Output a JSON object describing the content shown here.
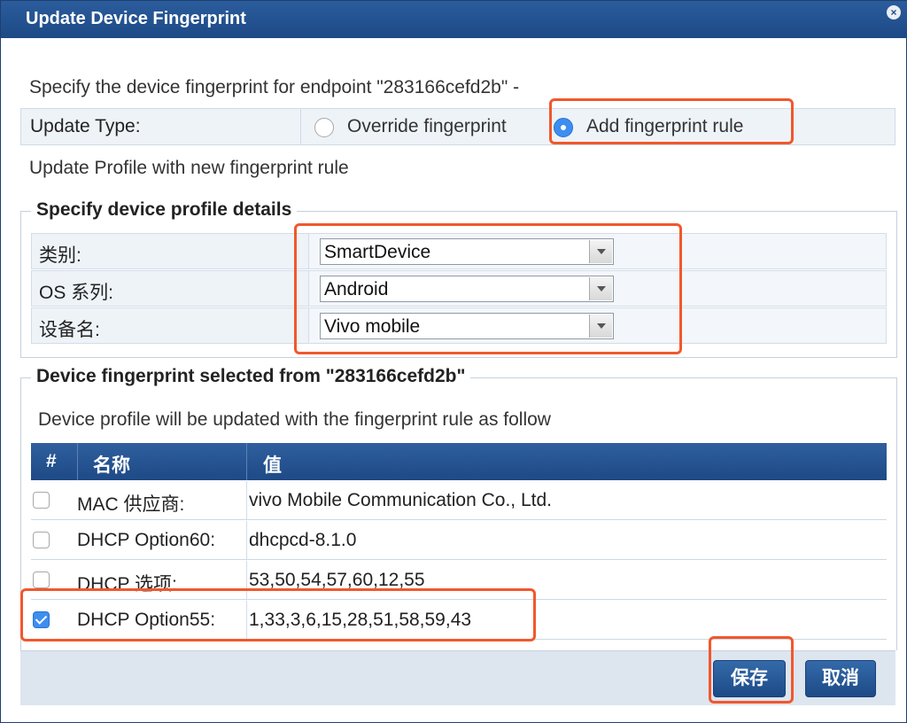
{
  "dialog": {
    "title": "Update Device Fingerprint",
    "close_label": "×"
  },
  "intro": "Specify the device fingerprint for endpoint \"283166cefd2b\" -",
  "update_type": {
    "label": "Update Type:",
    "options": [
      {
        "label": "Override fingerprint",
        "selected": false
      },
      {
        "label": "Add fingerprint rule",
        "selected": true
      }
    ]
  },
  "profile_note": "Update Profile with new fingerprint rule",
  "profile_section": {
    "title": "Specify device profile details",
    "fields": [
      {
        "label": "类别:",
        "value": "SmartDevice"
      },
      {
        "label": "OS 系列:",
        "value": "Android"
      },
      {
        "label": "设备名:",
        "value": "Vivo mobile"
      }
    ]
  },
  "fingerprint_section": {
    "title": "Device fingerprint selected from \"283166cefd2b\"",
    "description": "Device profile will be updated with the fingerprint rule as follow",
    "columns": [
      "#",
      "名称",
      "值"
    ],
    "rows": [
      {
        "checked": false,
        "name": "MAC 供应商:",
        "value": "vivo Mobile Communication Co., Ltd."
      },
      {
        "checked": false,
        "name": "DHCP Option60:",
        "value": "dhcpcd-8.1.0"
      },
      {
        "checked": false,
        "name": "DHCP 选项:",
        "value": "53,50,54,57,60,12,55"
      },
      {
        "checked": true,
        "name": "DHCP Option55:",
        "value": "1,33,3,6,15,28,51,58,59,43"
      }
    ]
  },
  "buttons": {
    "save": "保存",
    "cancel": "取消"
  },
  "colors": {
    "title_bar": "#1d4a86",
    "table_header": "#1e4a86",
    "highlight": "#f2572c",
    "radio_selected": "#3d8ef0"
  }
}
